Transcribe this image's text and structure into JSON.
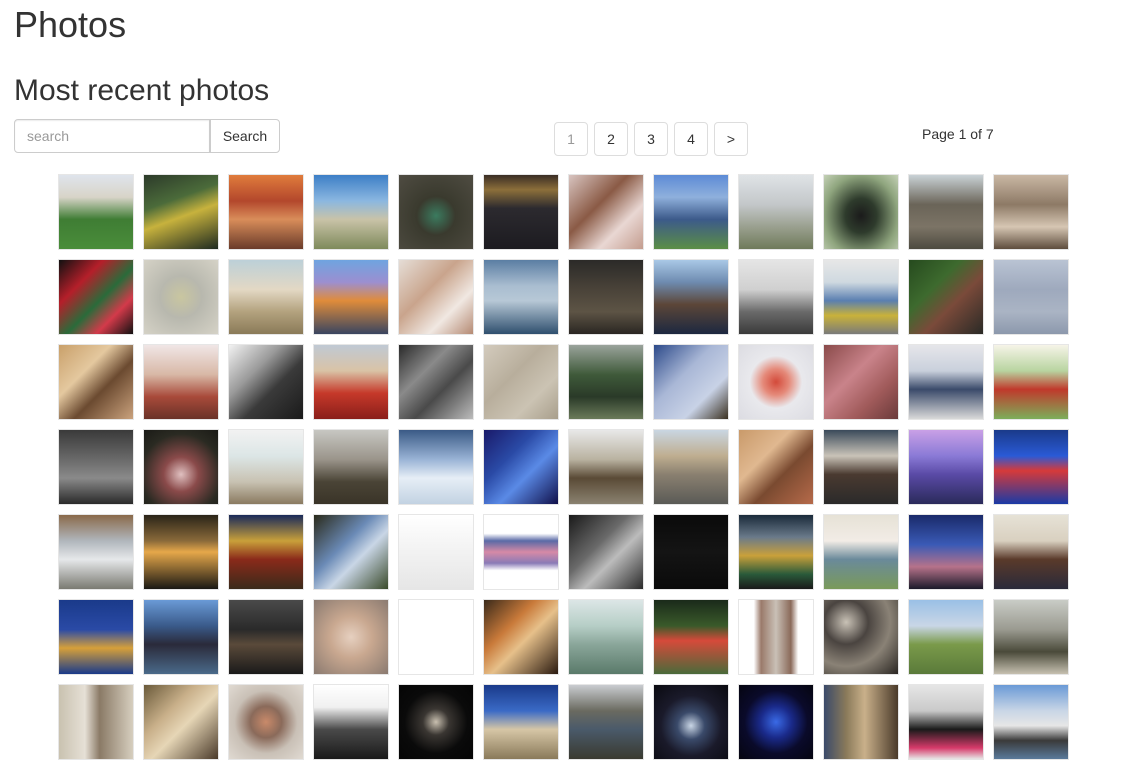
{
  "header": {
    "title": "Photos"
  },
  "section": {
    "title": "Most recent photos"
  },
  "search": {
    "placeholder": "search",
    "value": "",
    "button_label": "Search"
  },
  "pagination": {
    "pages": [
      "1",
      "2",
      "3",
      "4"
    ],
    "current": "1",
    "next_label": ">",
    "status": "Page 1 of 7"
  },
  "photos": [
    {
      "name": "soccer-players",
      "bg": "linear-gradient(180deg,#dfe4ec 0%,#d8d4c8 30%,#3f7d34 60%,#4a8d3a 100%)"
    },
    {
      "name": "basketball-crowd",
      "bg": "linear-gradient(160deg,#2c3a2a 0%,#4b6b3a 35%,#c7b23d 55%,#1e2a20 100%)"
    },
    {
      "name": "restaurant-interior",
      "bg": "linear-gradient(180deg,#e07c3c 0%,#b3472c 35%,#d98d5a 60%,#6a3b2a 100%)"
    },
    {
      "name": "sand-dunes-sky",
      "bg": "linear-gradient(180deg,#3d7fc6 0%,#8bb7e0 35%,#c9c3a8 60%,#7e8a5b 100%)"
    },
    {
      "name": "duck-on-water",
      "bg": "radial-gradient(circle at 50% 55%,#3b7b5f 0%,#3a3a2e 35%,#4f4c42 100%)"
    },
    {
      "name": "monsterville-poster",
      "bg": "linear-gradient(180deg,#3a2d25 0%,#8c6f3a 20%,#2c2a2f 45%,#1c1b20 100%)"
    },
    {
      "name": "woman-portrait",
      "bg": "linear-gradient(135deg,#d8c4c0 0%,#8a5a45 40%,#e9d7d3 70%,#c39c8e 100%)"
    },
    {
      "name": "group-of-people",
      "bg": "linear-gradient(180deg,#5d8bd6 0%,#8fb0dc 30%,#3c5a8a 60%,#5b8e45 100%)"
    },
    {
      "name": "coastal-pier",
      "bg": "linear-gradient(180deg,#dfe3e6 0%,#c3c7c9 40%,#9aa08f 70%,#6f7a5a 100%)"
    },
    {
      "name": "black-butterfly",
      "bg": "radial-gradient(ellipse at 50% 55%,#1b1b1b 0%,#2e3b2c 30%,#8fa57e 70%,#c4d1b6 100%)"
    },
    {
      "name": "man-on-tree",
      "bg": "linear-gradient(180deg,#c9d2d6 0%,#6a6458 40%,#7c7466 70%,#4d4a40 100%)"
    },
    {
      "name": "wooden-letters",
      "bg": "linear-gradient(180deg,#c9b7a4 0%,#8d7a66 40%,#d6c6b3 70%,#5e4d3d 100%)"
    },
    {
      "name": "colorful-objects",
      "bg": "linear-gradient(135deg,#111 0%,#b51f2a 30%,#2a6b3a 55%,#d33a4a 75%,#111 100%)"
    },
    {
      "name": "bird-on-branch",
      "bg": "radial-gradient(circle at 50% 50%,#c9c6a0 0%,#b8b8ae 40%,#d5d2c6 100%)"
    },
    {
      "name": "cyclist",
      "bg": "linear-gradient(180deg,#bcd0d8 0%,#e3d8c4 40%,#b3a27e 70%,#8a7a58 100%)"
    },
    {
      "name": "hot-air-balloons",
      "bg": "linear-gradient(180deg,#6fa4e0 0%,#9c8fd0 30%,#e08c3a 55%,#3a4560 100%)"
    },
    {
      "name": "child-portrait",
      "bg": "linear-gradient(135deg,#e5ddd6 0%,#c9a48c 40%,#f0e8e2 70%,#b58a73 100%)"
    },
    {
      "name": "sea-with-ship",
      "bg": "linear-gradient(180deg,#5b7ea3 0%,#a9bdd0 35%,#b7c8d6 55%,#2f4f6e 100%)"
    },
    {
      "name": "dark-room",
      "bg": "linear-gradient(180deg,#2b2a28 0%,#4a4339 40%,#5d5445 70%,#2a2622 100%)"
    },
    {
      "name": "selfie-couple",
      "bg": "linear-gradient(180deg,#a9c8e6 0%,#6e8bb0 30%,#5c4638 60%,#1c2840 100%)"
    },
    {
      "name": "declutter-laptop",
      "bg": "linear-gradient(180deg,#e5e5e5 0%,#d0d0d0 40%,#6a6a6a 70%,#3a3a3a 100%)"
    },
    {
      "name": "street-crowd",
      "bg": "linear-gradient(180deg,#e7e7e7 0%,#cfd9e0 30%,#5a7fb0 55%,#c9b23a 75%,#7a7a7a 100%)"
    },
    {
      "name": "sleeping-dog",
      "bg": "linear-gradient(135deg,#264a1e 0%,#3d6a2e 35%,#7a4a3a 60%,#2a2a26 100%)"
    },
    {
      "name": "airplane",
      "bg": "linear-gradient(180deg,#b9c3d3 0%,#9ea9bd 40%,#aab4c4 70%,#8c98ac 100%)"
    },
    {
      "name": "family-selfie",
      "bg": "linear-gradient(135deg,#c9a06a 0%,#e4c89f 35%,#6b4a30 60%,#caa27d 100%)"
    },
    {
      "name": "toddler-eating",
      "bg": "linear-gradient(180deg,#f0e6e6 0%,#d8b8a6 40%,#a84a3a 70%,#6a3228 100%)"
    },
    {
      "name": "mountain-bw",
      "bg": "linear-gradient(135deg,#f2f2f2 0%,#9a9a9a 35%,#3a3a3a 60%,#1a1a1a 100%)"
    },
    {
      "name": "man-with-helmet",
      "bg": "linear-gradient(180deg,#bfc9d4 0%,#d9c3a6 35%,#c6392a 65%,#8a1f1a 100%)"
    },
    {
      "name": "building-bw",
      "bg": "linear-gradient(135deg,#2a2a2a 0%,#8a8a8a 35%,#4a4a4a 60%,#bcbcbc 100%)"
    },
    {
      "name": "concrete-texture",
      "bg": "linear-gradient(135deg,#d3cbbd 0%,#b8ae9c 40%,#cbc3b3 70%,#a89e8b 100%)"
    },
    {
      "name": "game-character",
      "bg": "linear-gradient(180deg,#9aa39b 0%,#3f5a3a 40%,#2a3a28 70%,#6a7a5a 100%)"
    },
    {
      "name": "bird-on-twig",
      "bg": "linear-gradient(135deg,#2c4a8a 0%,#a9b7d6 40%,#c8d2e6 70%,#3a3020 100%)"
    },
    {
      "name": "red-feather",
      "bg": "radial-gradient(ellipse at 50% 50%,#d34a3a 0%,#e58a7a 25%,#e9e9ed 50%,#dcdce2 100%)"
    },
    {
      "name": "pink-sand-drawing",
      "bg": "linear-gradient(135deg,#8a4a4a 0%,#c9838a 40%,#a05a5a 70%,#6a3a3a 100%)"
    },
    {
      "name": "conference-hall",
      "bg": "linear-gradient(180deg,#e6e6ea 0%,#c9d0dc 35%,#3a4a6a 60%,#d9d9d9 100%)"
    },
    {
      "name": "archer-illustration",
      "bg": "linear-gradient(180deg,#f6f4e8 0%,#b8d4a0 35%,#c0392b 60%,#7cae5a 100%)"
    },
    {
      "name": "stormy-sky",
      "bg": "linear-gradient(180deg,#3a3a3a 0%,#6a6a6a 40%,#8a8a8a 65%,#2a2a2a 100%)"
    },
    {
      "name": "pussy-willow",
      "bg": "radial-gradient(circle at 50% 60%,#e0c0c0 0%,#8a4a4a 30%,#2a2a22 70%,#1a1a16 100%)"
    },
    {
      "name": "beach-minimal",
      "bg": "linear-gradient(180deg,#f2f2f2 0%,#dce6e6 35%,#c8c2b2 70%,#8a7a60 100%)"
    },
    {
      "name": "bare-tree",
      "bg": "linear-gradient(180deg,#c7c7c2 0%,#9a948a 40%,#4a4436 70%,#3a3428 100%)"
    },
    {
      "name": "snowy-mountains",
      "bg": "linear-gradient(180deg,#3a5a86 0%,#9ab4d6 40%,#e6eef6 65%,#c2d2e2 100%)"
    },
    {
      "name": "blue-night-scene",
      "bg": "linear-gradient(135deg,#1a1a6a 0%,#2a4aa6 35%,#5a8ae6 60%,#10104a 100%)"
    },
    {
      "name": "dogs-on-road",
      "bg": "linear-gradient(180deg,#e8e8e8 0%,#b9b2a0 40%,#5a4a36 65%,#8a8270 100%)"
    },
    {
      "name": "village-street",
      "bg": "linear-gradient(180deg,#c9d6e2 0%,#bfae90 35%,#8a8070 60%,#5a5a56 100%)"
    },
    {
      "name": "woman-selfie",
      "bg": "linear-gradient(135deg,#c99a6a 0%,#e0b890 35%,#7a4a30 60%,#b66a4a 100%)"
    },
    {
      "name": "workshop-room",
      "bg": "linear-gradient(180deg,#3a4a5a 0%,#c9c3b8 35%,#4a3a30 60%,#2a2a2a 100%)"
    },
    {
      "name": "disney-castle",
      "bg": "linear-gradient(180deg,#c9a0e6 0%,#8a7ad6 35%,#5a4aa6 60%,#2a2a5a 100%)"
    },
    {
      "name": "stadium-sign",
      "bg": "linear-gradient(180deg,#1a3a8a 0%,#2a5ad6 35%,#d63a3a 55%,#1a3aa6 100%)"
    },
    {
      "name": "silver-car",
      "bg": "linear-gradient(180deg,#8a6a4a 0%,#b0b6bc 35%,#e6e8ea 60%,#7a7a72 100%)"
    },
    {
      "name": "sunset-sea",
      "bg": "linear-gradient(180deg,#2a2418 0%,#8a6a3a 35%,#e6a84a 50%,#1a1814 100%)"
    },
    {
      "name": "beer-glass",
      "bg": "linear-gradient(180deg,#1a2a5a 0%,#c9a03a 35%,#8a2a1a 60%,#3a2a1a 100%)"
    },
    {
      "name": "window-sky",
      "bg": "linear-gradient(135deg,#2a2a1a 0%,#6a8ab6 40%,#c9d6e6 60%,#3a4a2a 100%)"
    },
    {
      "name": "resiliencia-poster",
      "bg": "linear-gradient(180deg,#ffffff 0%,#f2f2f2 50%,#e6e6e6 100%)"
    },
    {
      "name": "power-line-sunset",
      "bg": "linear-gradient(180deg,#ffffff 0%,#ffffff 25%,#5a6aa6 35%,#d68aa6 50%,#8a7ab6 65%,#ffffff 75%,#ffffff 100%)"
    },
    {
      "name": "car-interior",
      "bg": "linear-gradient(135deg,#1a1a1a 0%,#6a6a6a 40%,#bcbcbc 60%,#2a2a2a 100%)"
    },
    {
      "name": "black-image",
      "bg": "linear-gradient(180deg,#0a0a0a 0%,#141414 50%,#0a0a0a 100%)"
    },
    {
      "name": "market-hall",
      "bg": "linear-gradient(180deg,#1a2a3a 0%,#6a7a8a 30%,#c9a03a 55%,#2a5a3a 80%,#1a1a1a 100%)"
    },
    {
      "name": "baby-with-hat",
      "bg": "linear-gradient(180deg,#e6e2d6 0%,#f2ece6 35%,#6a8a9a 60%,#7a9a5a 100%)"
    },
    {
      "name": "tree-at-dusk",
      "bg": "linear-gradient(180deg,#1a2a6a 0%,#3a5ab6 40%,#b6728a 70%,#1a1a2a 100%)"
    },
    {
      "name": "group-indoor",
      "bg": "linear-gradient(180deg,#e6e2d6 0%,#d9d0c0 35%,#5a3a2a 60%,#2a2a3a 100%)"
    },
    {
      "name": "growth-infographic",
      "bg": "linear-gradient(180deg,#1a3a8a 0%,#2a4aa6 40%,#d6a03a 65%,#1a3a8a 100%)"
    },
    {
      "name": "man-with-fish",
      "bg": "linear-gradient(180deg,#6a9ad6 0%,#3a5a8a 35%,#2a2a3a 60%,#4a6a8a 100%)"
    },
    {
      "name": "night-city",
      "bg": "linear-gradient(180deg,#4a4a4a 0%,#2a2a2a 40%,#5a4a3a 60%,#1a1a1a 100%)"
    },
    {
      "name": "baby-face",
      "bg": "radial-gradient(circle at 50% 50%,#e6d0c0 0%,#c9a890 40%,#8a7a70 100%)"
    },
    {
      "name": "quote-card",
      "bg": "linear-gradient(180deg,#ffffff 0%,#ffffff 100%)"
    },
    {
      "name": "singer-on-stage",
      "bg": "linear-gradient(135deg,#3a2a1a 0%,#c97a3a 35%,#e6c08a 55%,#2a1a10 100%)"
    },
    {
      "name": "willow-tree",
      "bg": "linear-gradient(180deg,#dce6e6 0%,#b6cec6 35%,#8aa69a 60%,#5a7a6a 100%)"
    },
    {
      "name": "runners",
      "bg": "linear-gradient(180deg,#1a2a1a 0%,#3a5a2a 35%,#d64a3a 55%,#4a6a3a 100%)"
    },
    {
      "name": "tall-building",
      "bg": "linear-gradient(90deg,#ffffff 0%,#ffffff 20%,#9a7a6a 30%,#c9c0b6 50%,#8a6a5a 70%,#ffffff 80%,#ffffff 100%)"
    },
    {
      "name": "stones-pattern",
      "bg": "radial-gradient(circle at 30% 30%,#c9c2b6 0%,#4a4440 30%,#8a8276 60%,#2a2622 100%)"
    },
    {
      "name": "golf-course",
      "bg": "linear-gradient(180deg,#9ac0e6 0%,#c9d6e6 35%,#7a9a4a 60%,#5a7a3a 100%)"
    },
    {
      "name": "child-on-tree",
      "bg": "linear-gradient(180deg,#c9ccc6 0%,#9a9a90 40%,#4a4a3a 70%,#c6c0b0 100%)"
    },
    {
      "name": "empty-corridor",
      "bg": "linear-gradient(90deg,#c9c2b0 0%,#e6e0d6 35%,#8a7a66 55%,#d6cebe 100%)"
    },
    {
      "name": "glass-reflection",
      "bg": "linear-gradient(135deg,#6a5a3a 0%,#c9b08a 35%,#e6d6b6 55%,#4a3a2a 100%)"
    },
    {
      "name": "dried-flower",
      "bg": "radial-gradient(circle at 50% 50%,#c98a6a 0%,#8a6a5a 30%,#c9c0b6 60%,#e0dad2 100%)"
    },
    {
      "name": "street-lamps",
      "bg": "linear-gradient(180deg,#ffffff 0%,#f0f0f0 30%,#4a4a4a 60%,#1a1a1a 100%)"
    },
    {
      "name": "necklace-on-black",
      "bg": "radial-gradient(circle at 50% 50%,#c9c0b0 0%,#3a3632 25%,#0a0a0a 60%,#050505 100%)"
    },
    {
      "name": "old-building-tower",
      "bg": "linear-gradient(180deg,#1a3a8a 0%,#3a6ac6 35%,#d6c6a6 60%,#8a7a5a 100%)"
    },
    {
      "name": "gardeners",
      "bg": "linear-gradient(180deg,#c9ccd0 0%,#6a6a60 35%,#4a5a6a 60%,#3a3a30 100%)"
    },
    {
      "name": "glowing-screen",
      "bg": "radial-gradient(circle at 50% 55%,#c9d6e6 0%,#3a4a6a 25%,#1a1a2a 55%,#0a0a10 100%)"
    },
    {
      "name": "plasma-globe",
      "bg": "radial-gradient(circle at 50% 50%,#3a6ae6 0%,#1a2a8a 30%,#0a0a2a 60%,#050510 100%)"
    },
    {
      "name": "wooden-fence",
      "bg": "linear-gradient(90deg,#3a4a6a 0%,#8a7a5a 30%,#c9b08a 55%,#4a3a2a 100%)"
    },
    {
      "name": "black-white-cat",
      "bg": "linear-gradient(180deg,#e6e6e6 0%,#c9c9c9 35%,#1a1a1a 60%,#d63a6a 85%,#e6e6e6 100%)"
    },
    {
      "name": "steamboat",
      "bg": "linear-gradient(180deg,#6a9ad6 0%,#c9d6e6 35%,#e6e6e6 55%,#3a3a3a 75%,#5a7a9a 100%)"
    }
  ]
}
